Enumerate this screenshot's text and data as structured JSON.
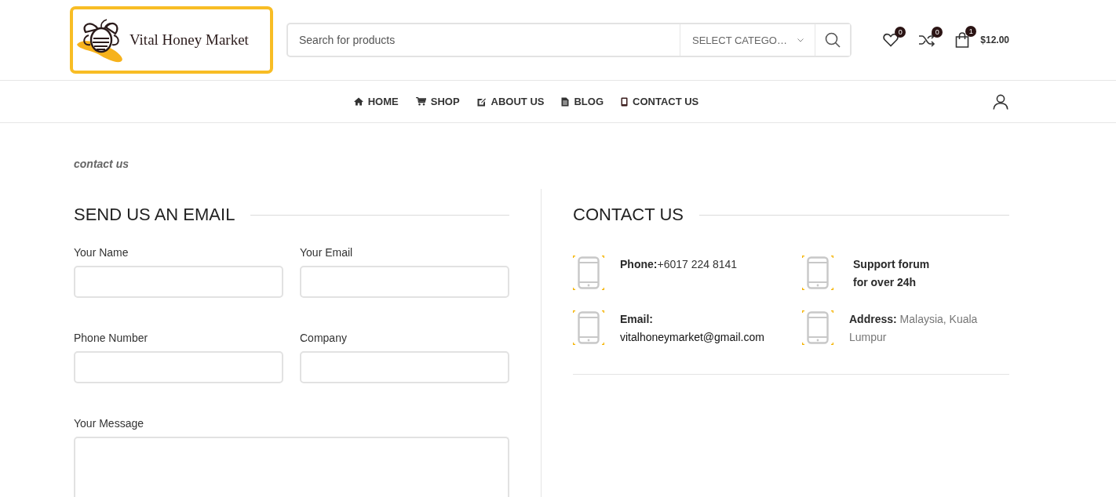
{
  "header": {
    "logo": {
      "text": "Vital Honey Market"
    },
    "search": {
      "placeholder": "Search for products",
      "category": "SELECT CATEGO…"
    },
    "actions": [
      {
        "kind": "wishlist",
        "count": "0"
      },
      {
        "kind": "compare",
        "count": "0"
      },
      {
        "kind": "cart",
        "count": "1",
        "total": "$12.00"
      }
    ]
  },
  "nav": {
    "items": [
      {
        "kind": "home",
        "label": "HOME"
      },
      {
        "kind": "shop",
        "label": "SHOP"
      },
      {
        "kind": "about",
        "label": "ABOUT US"
      },
      {
        "kind": "blog",
        "label": "BLOG"
      },
      {
        "kind": "contact",
        "label": "CONTACT US"
      }
    ]
  },
  "breadcrumb": "contact us",
  "form": {
    "title": "SEND US AN EMAIL",
    "fields": [
      {
        "kind": "input",
        "label": "Your Name"
      },
      {
        "kind": "input",
        "label": "Your Email"
      },
      {
        "kind": "input",
        "label": "Phone Number"
      },
      {
        "kind": "input",
        "label": "Company"
      },
      {
        "kind": "textarea",
        "label": "Your Message"
      }
    ]
  },
  "contact": {
    "title": "CONTACT US",
    "items": [
      {
        "kind": "phone",
        "text": "**Phone:**+6017 224 8141"
      },
      {
        "kind": "note",
        "text": "**Support forum**\n**for over 24h**"
      },
      {
        "kind": "email",
        "text": "**Email:** vitalhoneymarket@gmail.com"
      },
      {
        "kind": "address",
        "text": "**Address:** Malaysia, Kuala Lumpur"
      }
    ]
  }
}
